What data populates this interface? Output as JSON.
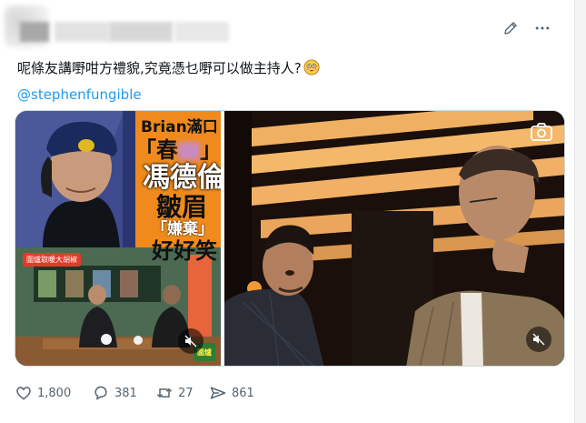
{
  "post": {
    "text": "呢條友講嘢咁方禮貌,究竟憑乜嘢可以做主持人?",
    "emoji": "flushed-face",
    "mention": "@stephenfungible"
  },
  "media": {
    "thumbnail": {
      "line1": "Brian",
      "line1_suffix": "滿口",
      "line2": "「春",
      "line2_suffix": "」",
      "line3": "馮德倫",
      "line4": "皺眉",
      "line5": "「嫌棄」",
      "line6": "好好笑",
      "badge": "圍爐取暖大胡椒",
      "corner_logo": "圍爐"
    },
    "icons": [
      "camera-icon",
      "mute-icon"
    ]
  },
  "actions": {
    "likes": "1,800",
    "replies": "381",
    "retweets": "27",
    "views": "861"
  },
  "colors": {
    "accent": "#1d9bf0",
    "muted": "#536471",
    "thumb_orange": "#f08a1c",
    "thumb_blue": "#3c4a8a"
  }
}
